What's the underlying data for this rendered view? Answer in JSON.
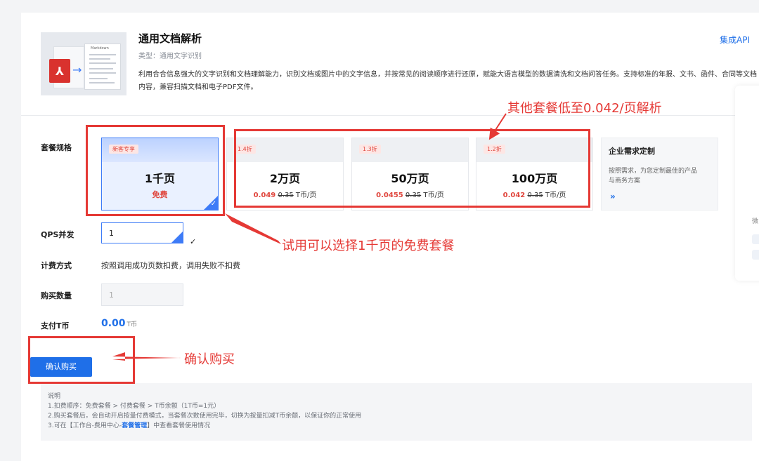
{
  "product": {
    "title": "通用文档解析",
    "type": "类型：通用文字识别",
    "description": "利用合合信息强大的文字识别和文档理解能力，识别文档或图片中的文字信息，并按常见的阅读顺序进行还原，赋能大语言模型的数据清洗和文档问答任务。支持标准的年报、文书、函件、合同等文档内容，兼容扫描文档和电子PDF文件。",
    "api_link": "集成API",
    "thumbnail_doc_title": "Markdown",
    "thumbnail_icon": "pdf-icon"
  },
  "labels": {
    "package": "套餐规格",
    "qps": "QPS并发",
    "billing": "计费方式",
    "quantity": "购买数量",
    "pay": "支付T币"
  },
  "packages": [
    {
      "badge": "新客专享",
      "name": "1千页",
      "free_label": "免费",
      "selected": true
    },
    {
      "badge": "1.4折",
      "name": "2万页",
      "price": "0.049",
      "original": "0.35",
      "unit": "T币/页"
    },
    {
      "badge": "1.3折",
      "name": "50万页",
      "price": "0.0455",
      "original": "0.35",
      "unit": "T币/页"
    },
    {
      "badge": "1.2折",
      "name": "100万页",
      "price": "0.042",
      "original": "0.35",
      "unit": "T币/页"
    }
  ],
  "enterprise": {
    "title": "企业需求定制",
    "desc": "按照需求，为您定制最佳的产品与商务方案",
    "go": "»"
  },
  "qps_value": "1",
  "billing_text": "按照调用成功页数扣费，调用失败不扣费",
  "quantity_value": "1",
  "pay_amount": "0.00",
  "pay_unit": "T币",
  "confirm_button": "确认购买",
  "notes": {
    "title": "说明",
    "line1": "1.扣费顺序：免费套餐 > 付费套餐 > T币余额（1T币=1元）",
    "line2": "2.购买套餐后，会自动开启按量付费模式，当套餐次数使用完毕，切换为按量扣减T币余额，以保证你的正常使用",
    "line3_pre": "3.可在【工作台-费用中心-",
    "line3_link": "套餐管理",
    "line3_post": "】中查看套餐使用情况"
  },
  "annotations": {
    "other": "其他套餐低至0.042/页解析",
    "trial": "试用可以选择1千页的免费套餐",
    "confirm": "确认购买"
  },
  "side_panel": {
    "char": "微"
  },
  "colors": {
    "accent": "#1f6fe8",
    "annotation": "#e53935",
    "price": "#e0463d"
  }
}
